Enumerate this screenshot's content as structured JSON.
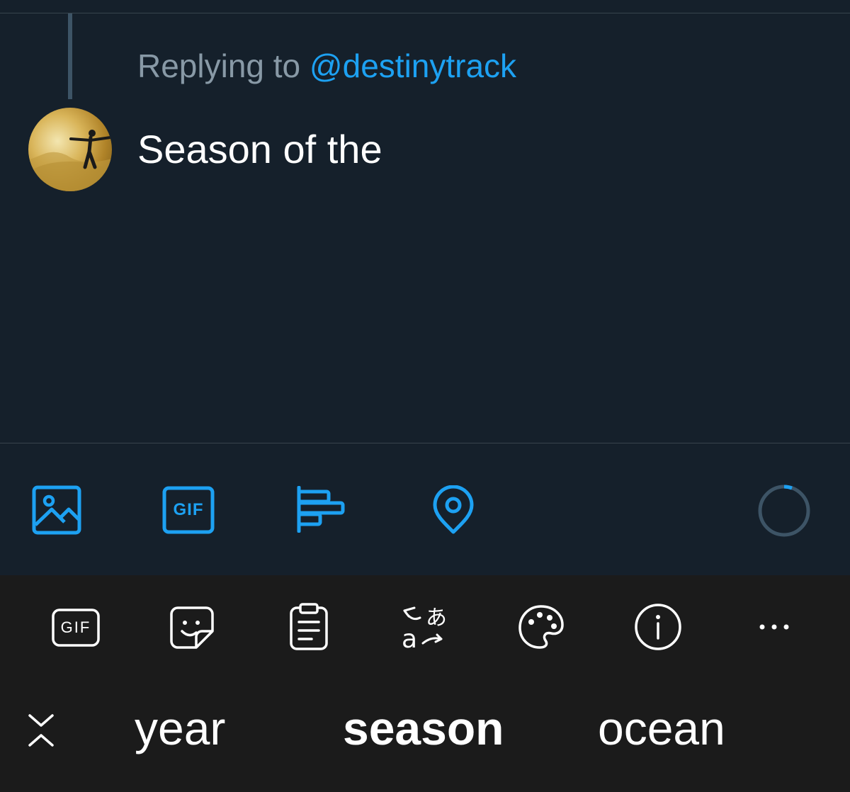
{
  "compose": {
    "replying_prefix": "Replying to",
    "replying_handle": "@destinytrack",
    "tweet_text": "Season of the"
  },
  "toolbar": {
    "items": [
      {
        "name": "image-icon"
      },
      {
        "name": "gif-icon",
        "label": "GIF"
      },
      {
        "name": "poll-icon"
      },
      {
        "name": "location-icon"
      },
      {
        "name": "character-count-ring"
      }
    ],
    "accent": "#1da1f2"
  },
  "keyboard_toolbar": {
    "gif_label": "GIF",
    "items": [
      "gif-icon",
      "sticker-icon",
      "clipboard-icon",
      "translate-icon",
      "palette-icon",
      "info-icon",
      "more-icon"
    ]
  },
  "suggestions": {
    "items": [
      "year",
      "season",
      "ocean"
    ],
    "selected": "season"
  },
  "colors": {
    "background": "#15202b",
    "keyboard_bg": "#1b1b1b",
    "muted_text": "#8899a6",
    "accent": "#1da1f2"
  }
}
